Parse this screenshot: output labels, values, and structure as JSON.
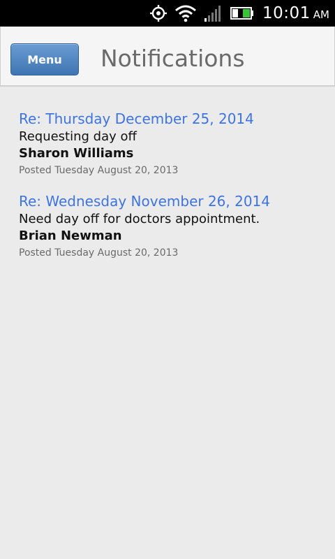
{
  "status_bar": {
    "time": "10:01",
    "ampm": "AM",
    "icons": [
      "gps-icon",
      "wifi-icon",
      "signal-icon",
      "battery-icon"
    ]
  },
  "header": {
    "menu_label": "Menu",
    "title": "Notifications"
  },
  "notifications": [
    {
      "subject": "Re: Thursday December 25, 2014",
      "message": "Requesting day off",
      "author": "Sharon Williams",
      "posted": "Posted Tuesday August 20, 2013"
    },
    {
      "subject": "Re: Wednesday November 26, 2014",
      "message": "Need day off for doctors appointment.",
      "author": "Brian Newman",
      "posted": "Posted Tuesday August 20, 2013"
    }
  ],
  "colors": {
    "link": "#3e74e0",
    "menu_button": "#4f84c2",
    "background": "#ebebeb"
  }
}
